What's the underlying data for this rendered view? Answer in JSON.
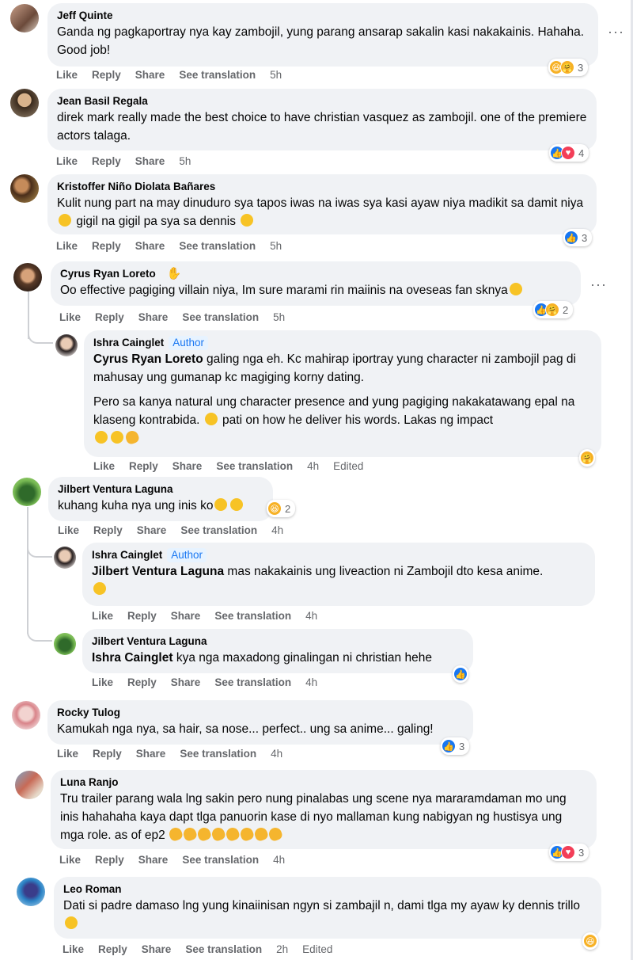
{
  "actions": {
    "like": "Like",
    "reply": "Reply",
    "share": "Share",
    "see_translation": "See translation",
    "edited": "Edited"
  },
  "author_badge": "Author",
  "comments": [
    {
      "author": "Jeff Quinte",
      "text": "Ganda ng pagkaportray nya kay zambojil, yung parang ansarap sakalin kasi nakakainis. Hahaha. Good job!",
      "time": "5h",
      "reaction_count": "3",
      "reactions": [
        "haha-icon",
        "care-icon"
      ]
    },
    {
      "author": "Jean Basil Regala",
      "text": "direk mark really made the best choice to have christian vasquez as zambojil. one of the premiere actors talaga.",
      "time": "5h",
      "reaction_count": "4",
      "reactions": [
        "like-icon",
        "love-icon"
      ]
    },
    {
      "author": "Kristoffer Niño Diolata Bañares",
      "text_a": "Kulit nung part na may dinuduro sya tapos iwas na iwas sya kasi ayaw niya madikit sa damit niya",
      "text_b": "gigil na gigil pa sya sa dennis",
      "time": "5h",
      "reaction_count": "3",
      "reactions": [
        "like-icon"
      ]
    },
    {
      "author": "Cyrus Ryan Loreto",
      "text": "Oo effective pagiging villain niya, Im sure marami rin maiinis na oveseas fan sknya",
      "time": "5h",
      "reaction_count": "2",
      "reactions": [
        "like-icon",
        "care-icon"
      ]
    },
    {
      "author": "Ishra Cainglet",
      "mention": "Cyrus Ryan Loreto",
      "text_a": "galing nga eh. Kc mahirap iportray yung character ni zambojil pag di mahusay ung gumanap kc magiging korny dating.",
      "text_b": "Pero sa kanya natural ung character presence and yung pagiging nakakatawang epal na klaseng kontrabida.",
      "text_c": "pati on how he deliver his words. Lakas ng impact",
      "time": "4h",
      "reactions": [
        "care-icon"
      ]
    },
    {
      "author": "Jilbert Ventura Laguna",
      "text": "kuhang kuha nya ung inis ko",
      "time": "4h",
      "reaction_count": "2",
      "reactions": [
        "haha-icon"
      ]
    },
    {
      "author": "Ishra Cainglet",
      "mention": "Jilbert Ventura Laguna",
      "text": "mas nakakainis ung liveaction ni Zambojil dto kesa anime.",
      "time": "4h"
    },
    {
      "author": "Jilbert Ventura Laguna",
      "mention": "Ishra Cainglet",
      "text": "kya nga maxadong ginalingan ni christian hehe",
      "time": "4h",
      "reactions": [
        "like-icon"
      ]
    },
    {
      "author": "Rocky Tulog",
      "text": "Kamukah nga nya, sa hair, sa nose... perfect.. ung sa anime... galing!",
      "time": "4h",
      "reaction_count": "3",
      "reactions": [
        "like-icon"
      ]
    },
    {
      "author": "Luna Ranjo",
      "text": "Tru trailer parang wala lng sakin pero nung pinalabas ung scene nya mararamdaman mo ung inis hahahaha kaya dapt tlga panuorin kase di nyo mallaman kung nabigyan ng hustisya ung mga role. as of ep2",
      "time": "4h",
      "reaction_count": "3",
      "reactions": [
        "like-icon",
        "love-icon"
      ]
    },
    {
      "author": "Leo Roman",
      "text": "Dati si padre damaso lng yung kinaiinisan ngyn si zambajil n, dami tlga my ayaw ky dennis trillo",
      "time": "2h",
      "reactions": [
        "haha-icon"
      ]
    }
  ],
  "colors": {
    "bubble": "#f0f2f5",
    "meta": "#65676b",
    "like": "#1877f2",
    "love": "#f33e58",
    "haha": "#f7b125",
    "author_badge_bg": "#e7f3ff"
  }
}
